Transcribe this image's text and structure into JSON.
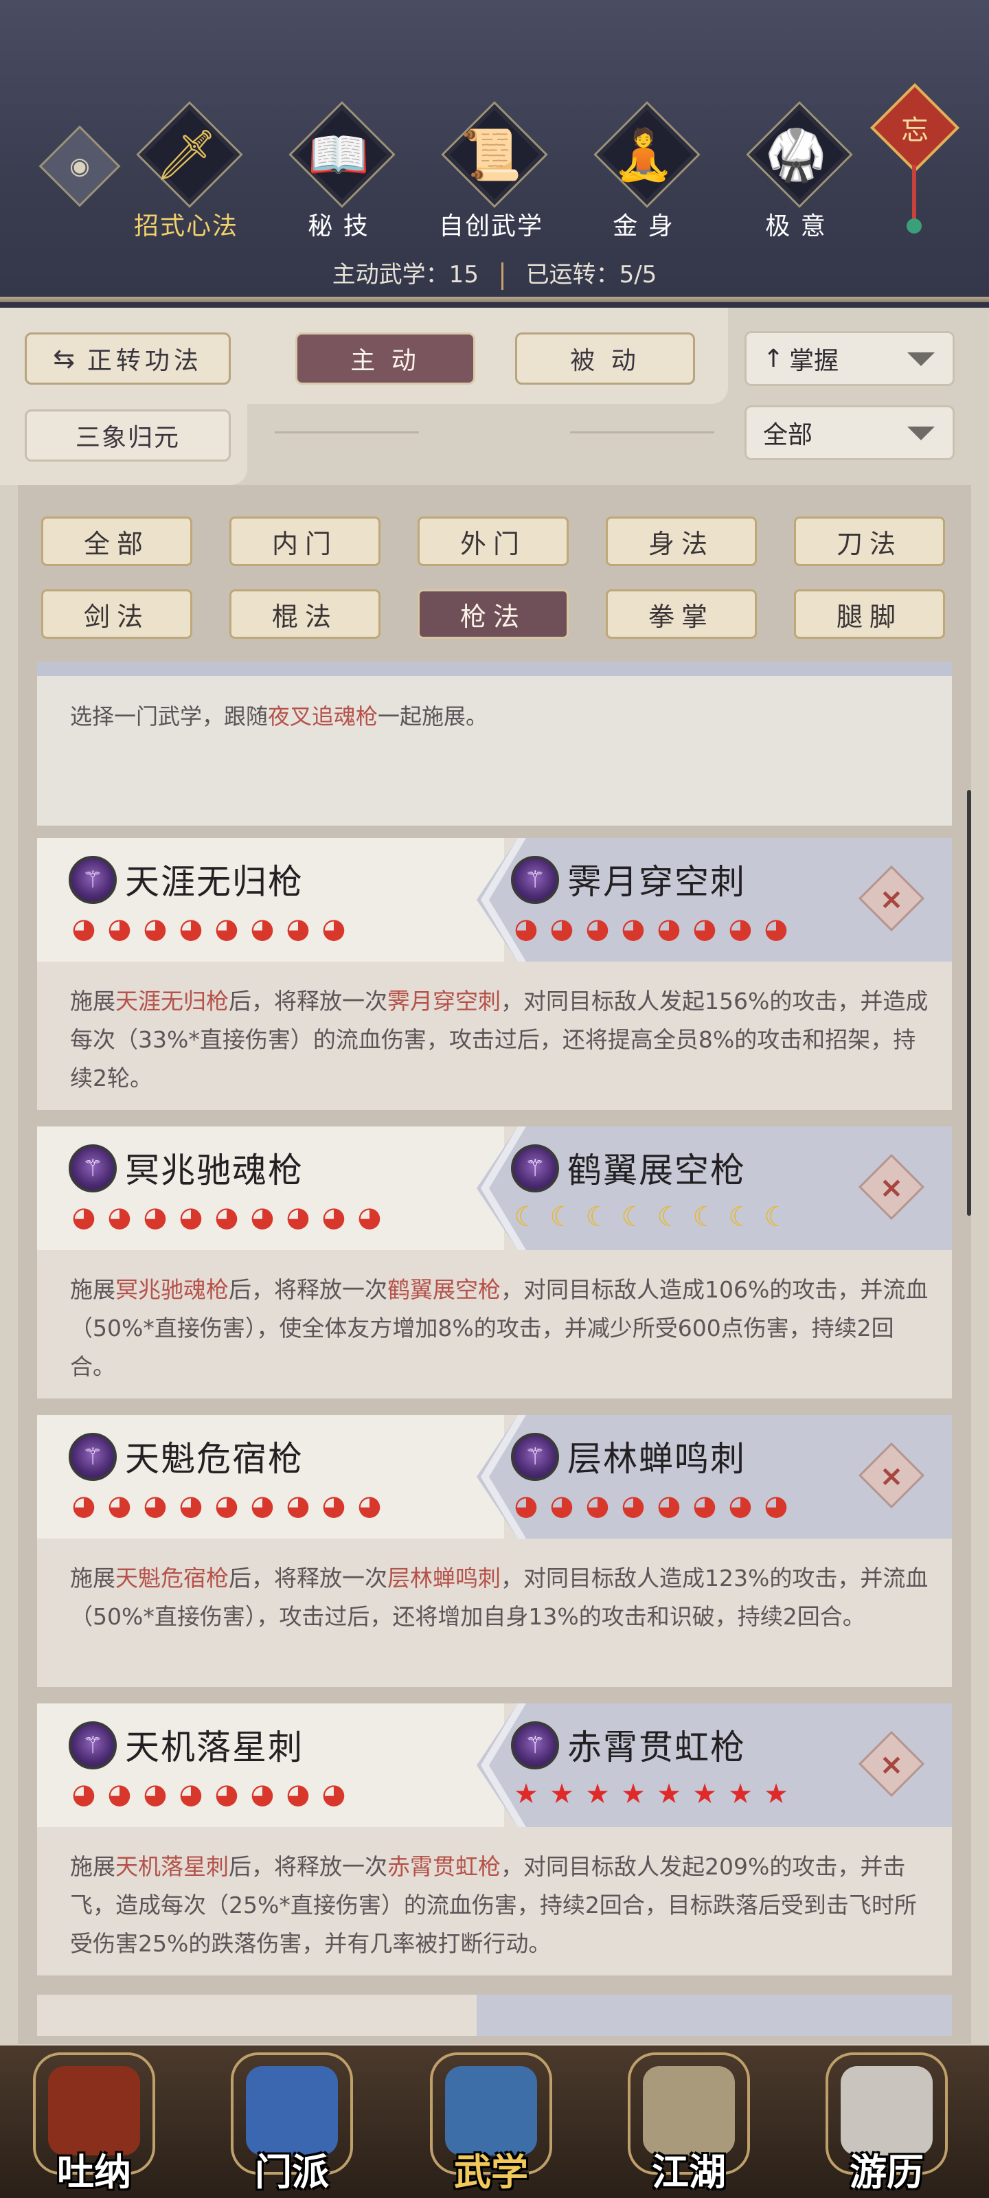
{
  "header": {
    "eye_icon": "eye-icon",
    "tabs": [
      {
        "label": "招式心法",
        "icon": "sword-icon",
        "glyph": "🗡",
        "active": true
      },
      {
        "label": "秘 技",
        "icon": "book-icon",
        "glyph": "📖",
        "active": false
      },
      {
        "label": "自创武学",
        "icon": "scroll-icon",
        "glyph": "📜",
        "active": false
      },
      {
        "label": "金 身",
        "icon": "meditation-icon",
        "glyph": "🧘",
        "active": false
      },
      {
        "label": "极 意",
        "icon": "martial-pose-icon",
        "glyph": "🥋",
        "active": false
      }
    ],
    "knot_char": "忘",
    "stats": {
      "active_label": "主动武学：15",
      "running_label": "已运转：5/5"
    }
  },
  "toolbar": {
    "convert_label": "正转功法",
    "active_label": "主 动",
    "passive_label": "被 动",
    "mastery_select": "掌握",
    "sanxiang_label": "三象归元",
    "scope_select": "全部"
  },
  "filters": [
    {
      "label": "全部",
      "active": false
    },
    {
      "label": "内门",
      "active": false
    },
    {
      "label": "外门",
      "active": false
    },
    {
      "label": "身法",
      "active": false
    },
    {
      "label": "刀法",
      "active": false
    },
    {
      "label": "剑法",
      "active": false
    },
    {
      "label": "棍法",
      "active": false
    },
    {
      "label": "枪法",
      "active": true
    },
    {
      "label": "拳掌",
      "active": false
    },
    {
      "label": "腿脚",
      "active": false
    }
  ],
  "intro": {
    "pre": "选择一门武学，跟随",
    "hl": "夜叉追魂枪",
    "post": "一起施展。"
  },
  "combos": [
    {
      "left_name": "天涯无归枪",
      "left_gems": 8,
      "left_gem_type": "red",
      "right_name": "霁月穿空刺",
      "right_gems": 8,
      "right_gem_type": "red",
      "desc": [
        {
          "t": "施展",
          "h": false
        },
        {
          "t": "天涯无归枪",
          "h": true
        },
        {
          "t": "后，将释放一次",
          "h": false
        },
        {
          "t": "霁月穿空刺",
          "h": true
        },
        {
          "t": "，对同目标敌人发起156%的攻击，并造成每次（33%*直接伤害）的流血伤害，攻击过后，还将提高全员8%的攻击和招架，持续2轮。",
          "h": false
        }
      ]
    },
    {
      "left_name": "冥兆驰魂枪",
      "left_gems": 9,
      "left_gem_type": "red",
      "right_name": "鹤翼展空枪",
      "right_gems": 8,
      "right_gem_type": "moon",
      "desc": [
        {
          "t": "施展",
          "h": false
        },
        {
          "t": "冥兆驰魂枪",
          "h": true
        },
        {
          "t": "后，将释放一次",
          "h": false
        },
        {
          "t": "鹤翼展空枪",
          "h": true
        },
        {
          "t": "，对同目标敌人造成106%的攻击，并流血（50%*直接伤害），使全体友方增加8%的攻击，并减少所受600点伤害，持续2回合。",
          "h": false
        }
      ]
    },
    {
      "left_name": "天魁危宿枪",
      "left_gems": 9,
      "left_gem_type": "red",
      "right_name": "层林蝉鸣刺",
      "right_gems": 8,
      "right_gem_type": "red",
      "desc": [
        {
          "t": "施展",
          "h": false
        },
        {
          "t": "天魁危宿枪",
          "h": true
        },
        {
          "t": "后，将释放一次",
          "h": false
        },
        {
          "t": "层林蝉鸣刺",
          "h": true
        },
        {
          "t": "，对同目标敌人造成123%的攻击，并流血（50%*直接伤害），攻击过后，还将增加自身13%的攻击和识破，持续2回合。",
          "h": false
        }
      ]
    },
    {
      "left_name": "天机落星刺",
      "left_gems": 8,
      "left_gem_type": "red",
      "right_name": "赤霄贯虹枪",
      "right_gems": 8,
      "right_gem_type": "star",
      "desc": [
        {
          "t": "施展",
          "h": false
        },
        {
          "t": "天机落星刺",
          "h": true
        },
        {
          "t": "后，将释放一次",
          "h": false
        },
        {
          "t": "赤霄贯虹枪",
          "h": true
        },
        {
          "t": "，对同目标敌人发起209%的攻击，并击飞，造成每次（25%*直接伤害）的流血伤害，持续2回合，目标跌落后受到击飞时所受伤害25%的跌落伤害，并有几率被打断行动。",
          "h": false
        }
      ]
    }
  ],
  "bottom_nav": [
    {
      "label": "吐纳",
      "icon": "monk-icon",
      "color": "#8a2f1c",
      "active": false
    },
    {
      "label": "门派",
      "icon": "banner-icon",
      "color": "#3b66b0",
      "active": false
    },
    {
      "label": "武学",
      "icon": "manual-book-icon",
      "color": "#3e6ea8",
      "active": true
    },
    {
      "label": "江湖",
      "icon": "straw-hat-icon",
      "color": "#a89a7a",
      "active": false
    },
    {
      "label": "游历",
      "icon": "horse-icon",
      "color": "#c9c4bd",
      "active": false
    }
  ],
  "colors": {
    "highlight": "#b5524a",
    "active_pill": "#7a555e",
    "gold": "#f2d26a"
  }
}
